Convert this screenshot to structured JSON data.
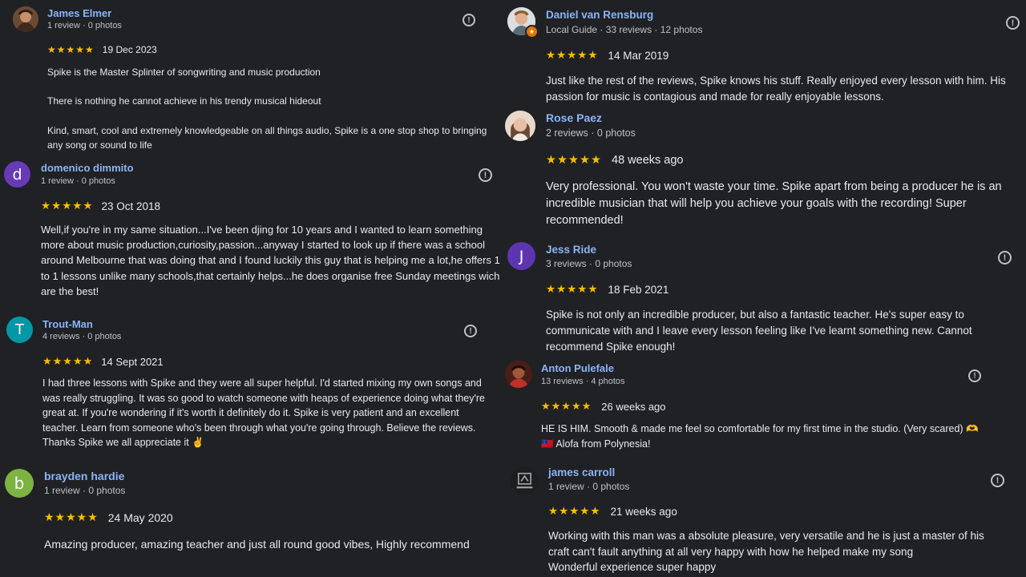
{
  "reviews": [
    {
      "name": "James Elmer",
      "meta": "1 review · 0 photos",
      "stars": "★★★★★",
      "date": "19 Dec 2023",
      "text": "Spike is the Master Splinter of songwriting and music production\n\nThere is nothing he cannot achieve in his trendy musical hideout\n\nKind, smart, cool and extremely knowledgeable on all things audio, Spike is a one stop shop to bringing any song or sound to life"
    },
    {
      "name": "domenico dimmito",
      "meta": "1 review · 0 photos",
      "avatar_letter": "d",
      "avatar_color": "#673ab7",
      "stars": "★★★★★",
      "date": "23 Oct 2018",
      "text": "Well,if you're in my same situation...I've been djing for 10 years and I wanted to learn something more about music production,curiosity,passion...anyway I started to look up if there was a school around Melbourne that was doing that and I found luckily this guy that is helping me a lot,he offers 1 to 1 lessons unlike many schools,that certainly helps...he does organise free Sunday meetings wich are the best!"
    },
    {
      "name": "Trout-Man",
      "meta": "4 reviews · 0 photos",
      "avatar_letter": "T",
      "avatar_color": "#0097a7",
      "stars": "★★★★★",
      "date": "14 Sept 2021",
      "text": "I had three lessons with Spike and they were all super helpful. I'd started mixing my own songs and was really struggling. It was so good to watch someone with heaps of experience doing what they're great at. If you're wondering if it's worth it definitely do it. Spike is very patient and an excellent teacher. Learn from someone who's been through what you're going through. Believe the reviews. Thanks Spike we all appreciate it ✌"
    },
    {
      "name": "brayden hardie",
      "meta": "1 review · 0 photos",
      "avatar_letter": "b",
      "avatar_color": "#7cb342",
      "stars": "★★★★★",
      "date": "24 May 2020",
      "text": "Amazing producer, amazing teacher and just all round good vibes, Highly recommend"
    },
    {
      "name": "Daniel van Rensburg",
      "meta": "Local Guide · 33 reviews · 12 photos",
      "stars": "★★★★★",
      "date": "14 Mar 2019",
      "text": "Just like the rest of the reviews, Spike knows his stuff. Really enjoyed every lesson with him. His passion for music is contagious and made for really enjoyable lessons."
    },
    {
      "name": "Rose Paez",
      "meta": "2 reviews · 0 photos",
      "stars": "★★★★★",
      "date": "48 weeks ago",
      "text": "Very professional. You won't waste your time. Spike apart from being a producer he is an incredible musician that will help you achieve your goals with the recording! Super recommended!"
    },
    {
      "name": "Jess Ride",
      "meta": "3 reviews · 0 photos",
      "avatar_letter": "J",
      "avatar_color": "#5e35b1",
      "stars": "★★★★★",
      "date": "18 Feb 2021",
      "text": "Spike is not only an incredible producer, but also a fantastic teacher. He's super easy to communicate with and I leave every lesson feeling like I've learnt something new. Cannot recommend Spike enough!"
    },
    {
      "name": "Anton Pulefale",
      "meta": "13 reviews · 4 photos",
      "stars": "★★★★★",
      "date": "26 weeks ago",
      "text": "HE IS HIM. Smooth & made me feel so comfortable for my first time in the studio. (Very scared) 🫶🇼🇸 Alofa from Polynesia!"
    },
    {
      "name": "james carroll",
      "meta": "1 review · 0 photos",
      "stars": "★★★★★",
      "date": "21 weeks ago",
      "text": "Working with this man was a absolute pleasure, very versatile and he is just a master of his craft can't fault anything at all very happy with how he helped make my song\nWonderful experience super happy"
    }
  ],
  "report_glyph": "!",
  "local_guide_badge": "★",
  "colors": {
    "background": "#202124",
    "name": "#8ab4f8",
    "star": "#fbbc04",
    "text": "#e8eaed",
    "meta": "#bdc1c6"
  }
}
